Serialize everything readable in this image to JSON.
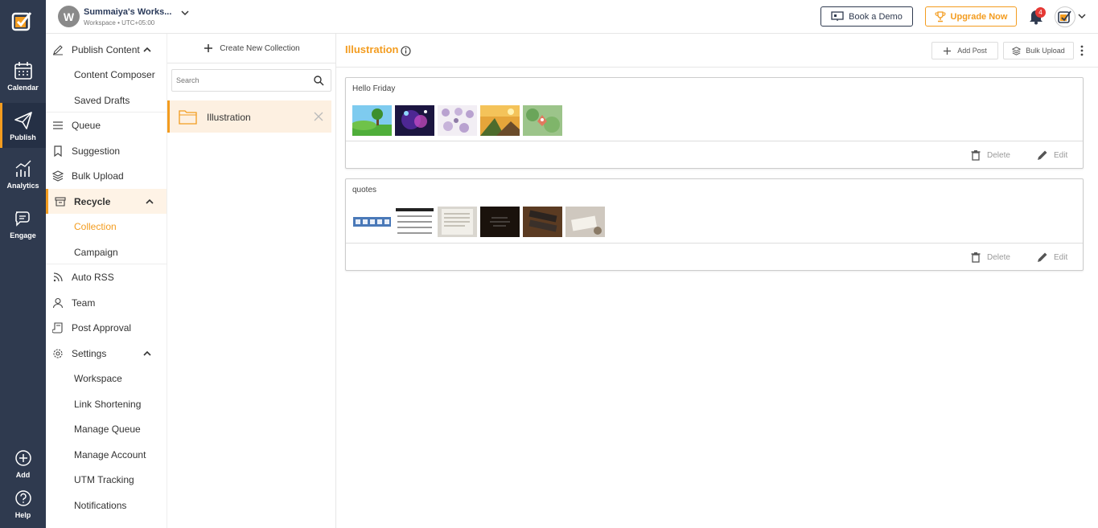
{
  "workspace": {
    "initial": "W",
    "name": "Summaiya's Works...",
    "sub": "Workspace • UTC+05:00"
  },
  "header": {
    "book_demo": "Book a Demo",
    "upgrade": "Upgrade Now",
    "notifications": "4"
  },
  "rail": {
    "items": [
      {
        "label": "Calendar",
        "icon": "calendar-icon"
      },
      {
        "label": "Publish",
        "icon": "paper-plane-icon"
      },
      {
        "label": "Analytics",
        "icon": "analytics-icon"
      },
      {
        "label": "Engage",
        "icon": "chat-icon"
      },
      {
        "label": "Add",
        "icon": "plus-circle-icon"
      },
      {
        "label": "Help",
        "icon": "help-icon"
      }
    ]
  },
  "sidebar": {
    "publish_content": "Publish Content",
    "content_composer": "Content Composer",
    "saved_drafts": "Saved Drafts",
    "queue": "Queue",
    "suggestion": "Suggestion",
    "bulk_upload": "Bulk Upload",
    "recycle": "Recycle",
    "collection": "Collection",
    "campaign": "Campaign",
    "auto_rss": "Auto RSS",
    "team": "Team",
    "post_approval": "Post Approval",
    "settings": "Settings",
    "workspace": "Workspace",
    "link_shortening": "Link Shortening",
    "manage_queue": "Manage Queue",
    "manage_account": "Manage Account",
    "utm_tracking": "UTM Tracking",
    "notifications": "Notifications"
  },
  "collections": {
    "create_label": "Create New Collection",
    "search_placeholder": "Search",
    "items": [
      {
        "name": "Illustration"
      }
    ]
  },
  "main": {
    "title": "Illustration",
    "add_post": "Add Post",
    "bulk_upload": "Bulk Upload",
    "delete_label": "Delete",
    "edit_label": "Edit",
    "posts": [
      {
        "title": "Hello Friday"
      },
      {
        "title": "quotes"
      }
    ]
  },
  "colors": {
    "accent": "#f39c1f",
    "rail": "#2f3a4f",
    "badge": "#e53935"
  }
}
